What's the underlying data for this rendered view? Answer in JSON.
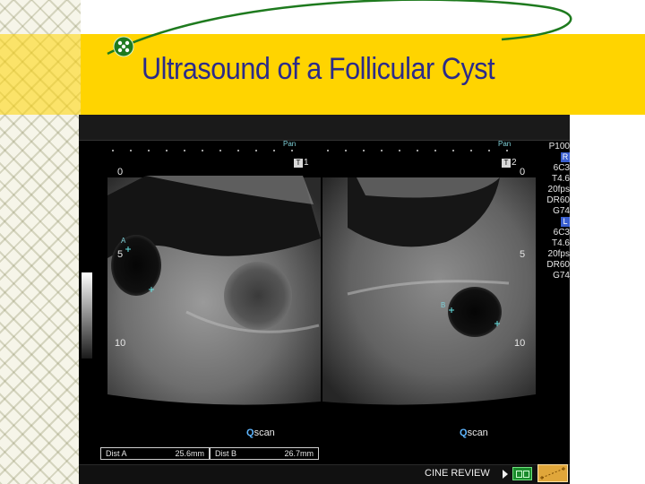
{
  "slide": {
    "title": "Ultrasound of a Follicular Cyst"
  },
  "colors": {
    "title_band": "#ffd400",
    "title_text": "#2b2b8a",
    "swoosh": "#1e7a1e",
    "measure_marker": "#66e0e0",
    "lr_badge": "#3a5fd0"
  },
  "scan": {
    "left_frame": {
      "pan_badge": "Pan",
      "frame_label": "T",
      "frame_number": "1",
      "depth_marks": [
        "0",
        "5",
        "10"
      ],
      "caliper_label": "A"
    },
    "right_frame": {
      "pan_badge": "Pan",
      "frame_label": "T",
      "frame_number": "2",
      "depth_marks": [
        "0",
        "5",
        "10"
      ],
      "caliper_label": "B"
    },
    "params": {
      "power": "P100",
      "right_marker": "R",
      "right": [
        "6C3",
        "T4.6",
        "20fps",
        "DR60",
        "G74"
      ],
      "left_marker": "L",
      "left": [
        "6C3",
        "T4.6",
        "20fps",
        "DR60",
        "G74"
      ]
    },
    "qscan_left": {
      "q": "Q",
      "text": "scan"
    },
    "qscan_right": {
      "q": "Q",
      "text": "scan"
    },
    "measurements": [
      {
        "label": "Dist A",
        "value": "25.6mm"
      },
      {
        "label": "Dist B",
        "value": "26.7mm"
      }
    ],
    "cine": {
      "label": "CINE REVIEW",
      "film_icon": "film-strip-icon",
      "caliper_icon": "caliper-icon"
    }
  }
}
